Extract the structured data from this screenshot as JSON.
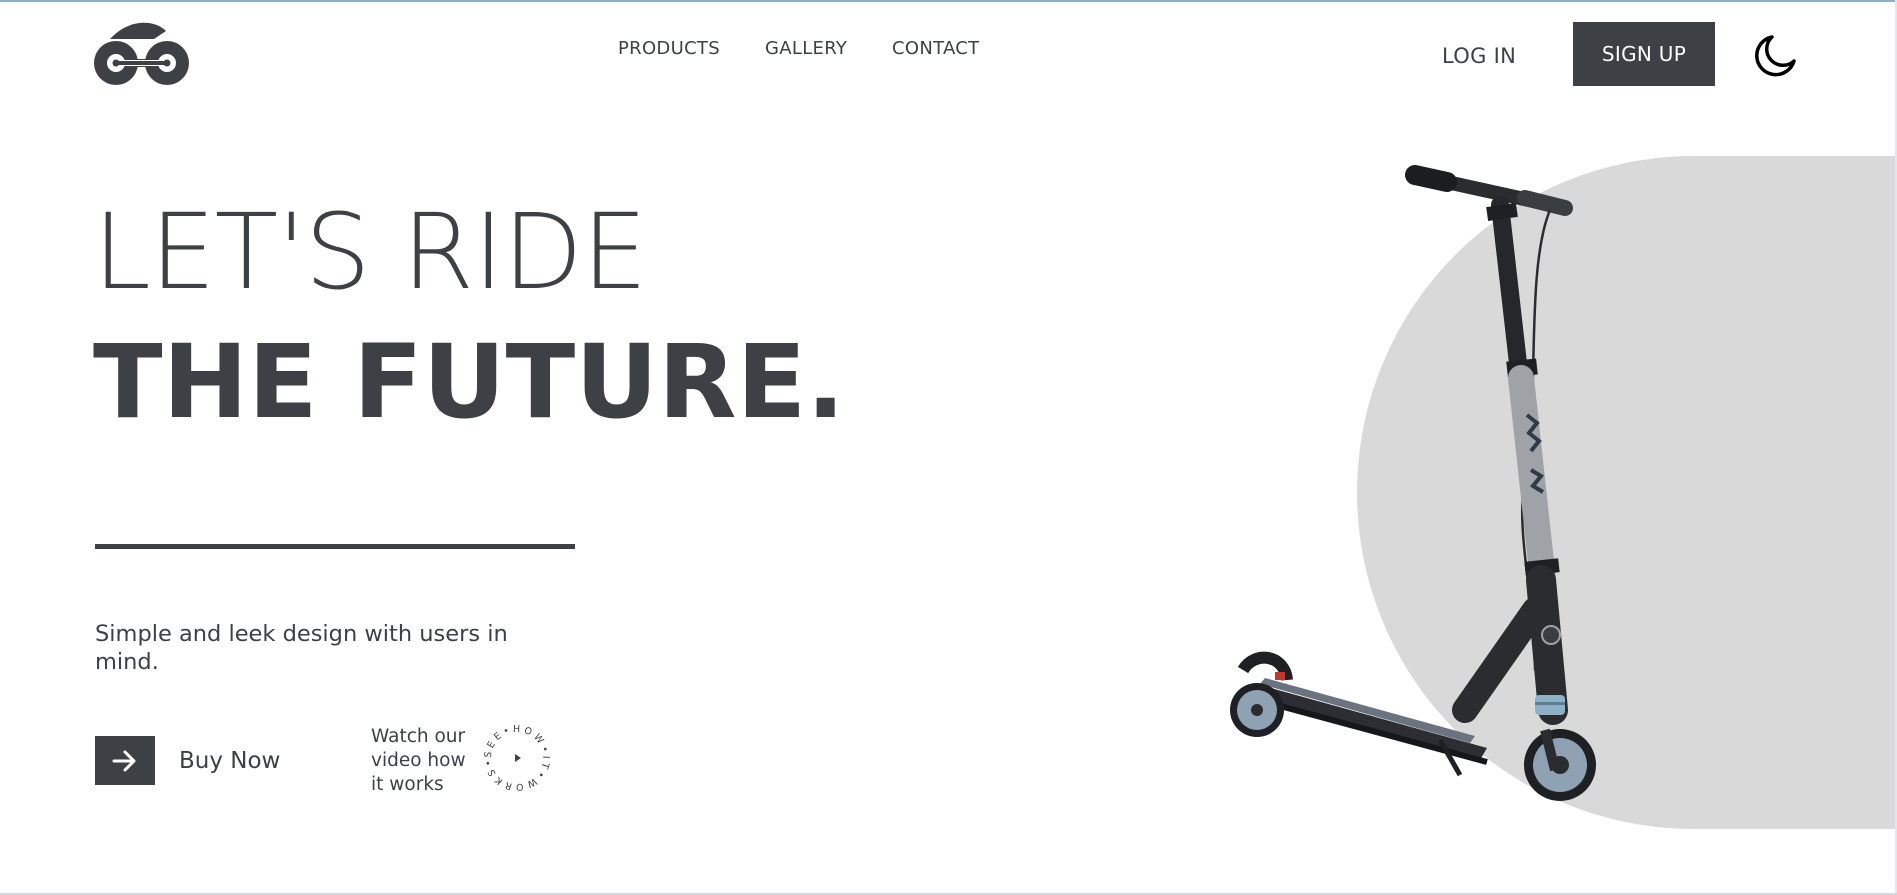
{
  "nav": {
    "links": [
      "PRODUCTS",
      "GALLERY",
      "CONTACT"
    ]
  },
  "auth": {
    "login_label": "LOG IN",
    "signup_label": "SIGN UP"
  },
  "hero": {
    "line1": "LET'S RIDE",
    "line2": "THE FUTURE.",
    "tagline": "Simple and leek design with users in mind.",
    "buy_label": "Buy Now",
    "watch_lines": [
      "Watch our",
      "video how",
      "it works"
    ],
    "badge_text": "SEE•HOW•IT•WORKS•"
  },
  "icons": {
    "logo": "bike-logo-icon",
    "theme": "moon-icon",
    "buy": "arrow-right-icon",
    "video": "play-icon"
  },
  "colors": {
    "primary": "#3d4045",
    "background": "#ffffff",
    "shape": "#d9d9d9"
  }
}
